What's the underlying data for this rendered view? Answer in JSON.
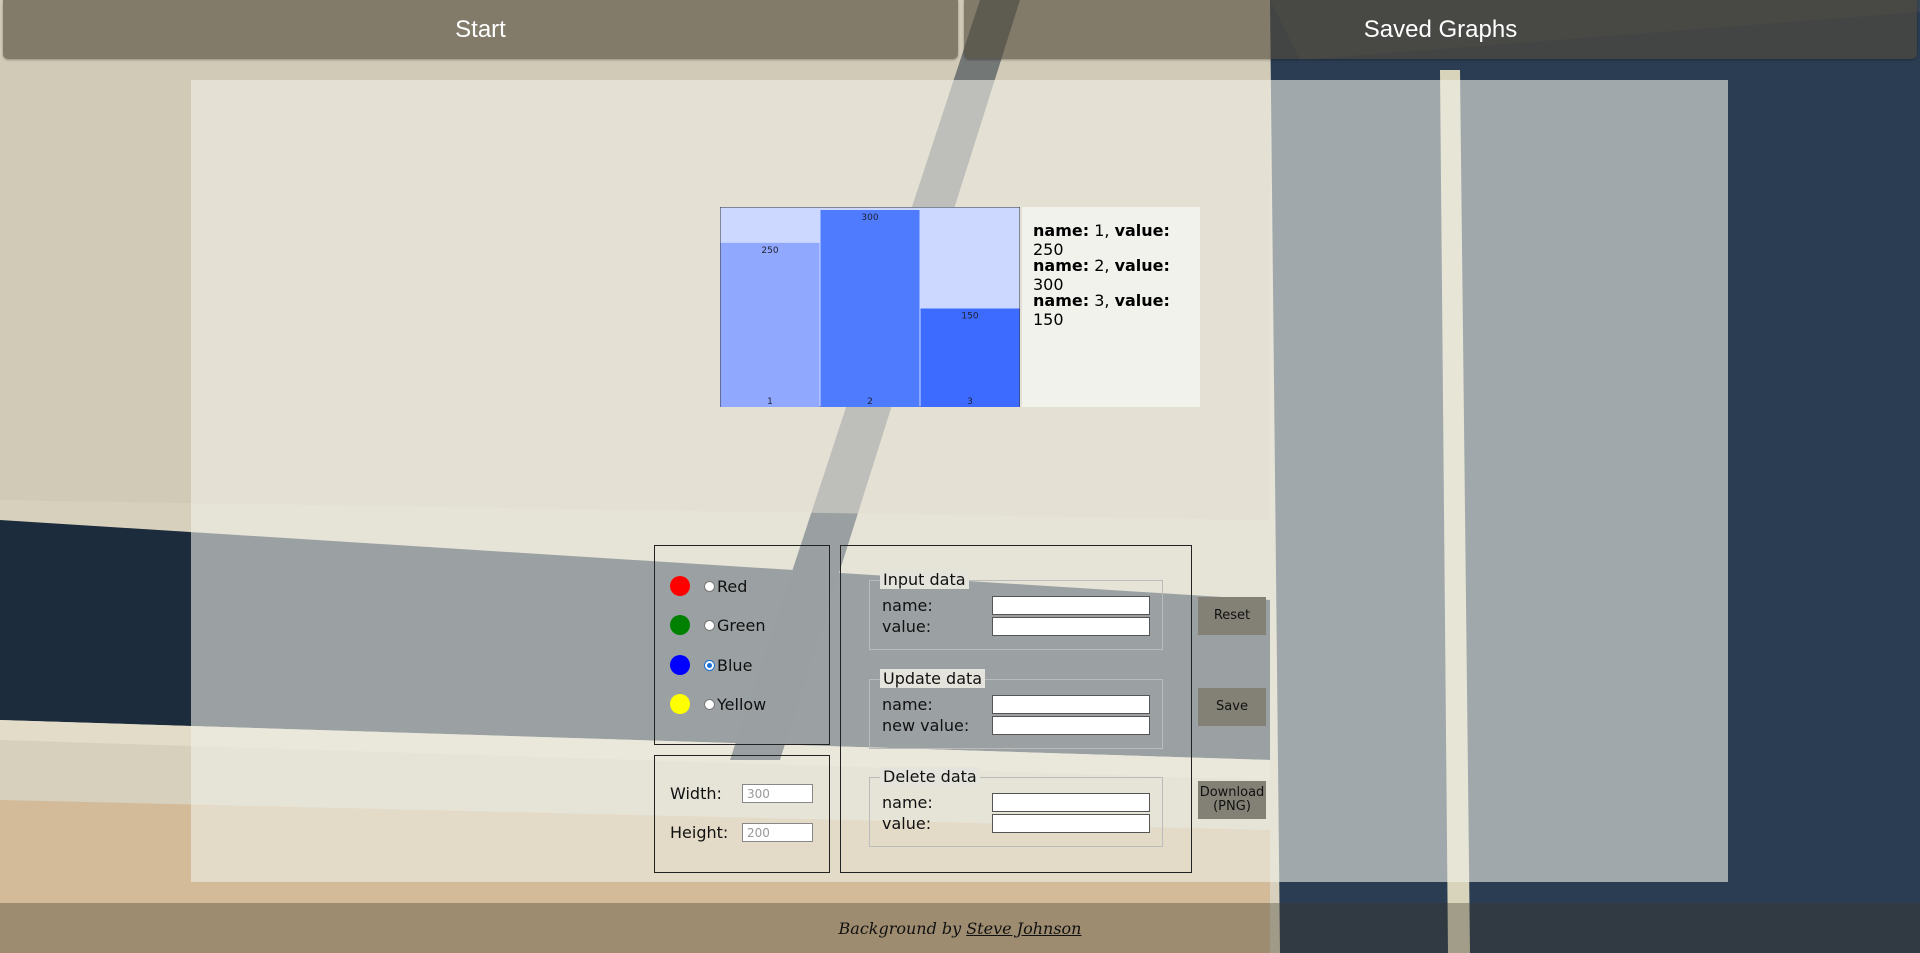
{
  "nav": {
    "start_label": "Start",
    "saved_label": "Saved Graphs"
  },
  "chart_data": {
    "type": "bar",
    "categories": [
      "1",
      "2",
      "3"
    ],
    "values": [
      250,
      300,
      150
    ],
    "ylim": [
      0,
      300
    ],
    "colors": [
      "#91a8ff",
      "#4f7cff",
      "#3d6bff"
    ],
    "background_color": "#ccd8ff"
  },
  "legend": [
    {
      "name_label": "name:",
      "name": "1",
      "value_label": "value:",
      "value": "250"
    },
    {
      "name_label": "name:",
      "name": "2",
      "value_label": "value:",
      "value": "300"
    },
    {
      "name_label": "name:",
      "name": "3",
      "value_label": "value:",
      "value": "150"
    }
  ],
  "colors": [
    {
      "label": "Red",
      "swatch": "#ff0000",
      "checked": false
    },
    {
      "label": "Green",
      "swatch": "#008000",
      "checked": false
    },
    {
      "label": "Blue",
      "swatch": "#0000ff",
      "checked": true
    },
    {
      "label": "Yellow",
      "swatch": "#ffff00",
      "checked": false
    }
  ],
  "size": {
    "width_label": "Width:",
    "width_placeholder": "300",
    "height_label": "Height:",
    "height_placeholder": "200"
  },
  "input_data": {
    "title": "Input data",
    "name_label": "name:",
    "value_label": "value:"
  },
  "update_data": {
    "title": "Update data",
    "name_label": "name:",
    "value_label": "new value:"
  },
  "delete_data": {
    "title": "Delete data",
    "name_label": "name:",
    "value_label": "value:"
  },
  "buttons": {
    "reset": "Reset",
    "save": "Save",
    "download_line1": "Download",
    "download_line2": "(PNG)"
  },
  "footer": {
    "prefix": "Background by",
    "author": "Steve Johnson"
  }
}
